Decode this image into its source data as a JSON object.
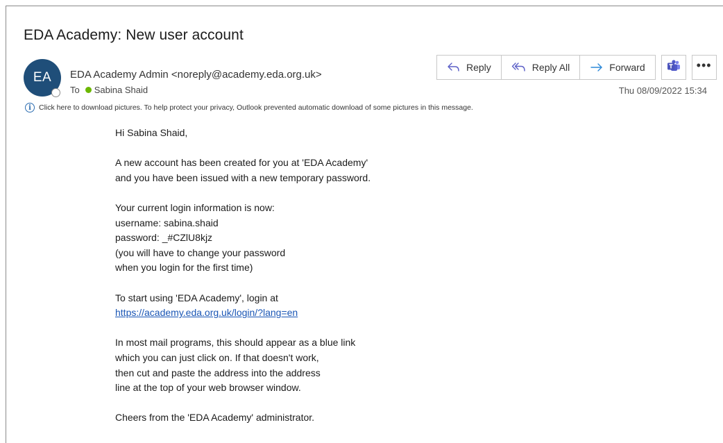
{
  "email": {
    "subject": "EDA Academy: New user account",
    "avatar_initials": "EA",
    "sender": "EDA Academy Admin <noreply@academy.eda.org.uk>",
    "to_label": "To",
    "recipient": "Sabina Shaid",
    "date": "Thu 08/09/2022 15:34",
    "info_bar": "Click here to download pictures. To help protect your privacy, Outlook prevented automatic download of some pictures in this message."
  },
  "toolbar": {
    "reply_label": "Reply",
    "reply_all_label": "Reply All",
    "forward_label": "Forward",
    "more_label": "•••"
  },
  "body": {
    "greeting": "Hi Sabina Shaid,",
    "p1_line1": "A new account has been created for you at 'EDA Academy'",
    "p1_line2": "and you have been issued with a new temporary password.",
    "p2_line1": "Your current login information is now:",
    "p2_line2": "username: sabina.shaid",
    "p2_line3": "password: _#CZlU8kjz",
    "p2_line4": "(you will have to change your password",
    "p2_line5": "when you login for the first time)",
    "p3_line1": "To start using 'EDA Academy', login at",
    "login_link": "https://academy.eda.org.uk/login/?lang=en",
    "p4_line1": "In most mail programs, this should appear as a blue link",
    "p4_line2": "which you can just click on. If that doesn't work,",
    "p4_line3": "then cut and paste the address into the address",
    "p4_line4": "line at the top of your web browser window.",
    "signoff": "Cheers from the 'EDA Academy' administrator."
  },
  "colors": {
    "avatar_bg": "#1f4e79",
    "presence_green": "#6bb700",
    "link_blue": "#1a56b5",
    "icon_purple": "#5b5fc7",
    "teams_purple": "#4b53bc"
  }
}
